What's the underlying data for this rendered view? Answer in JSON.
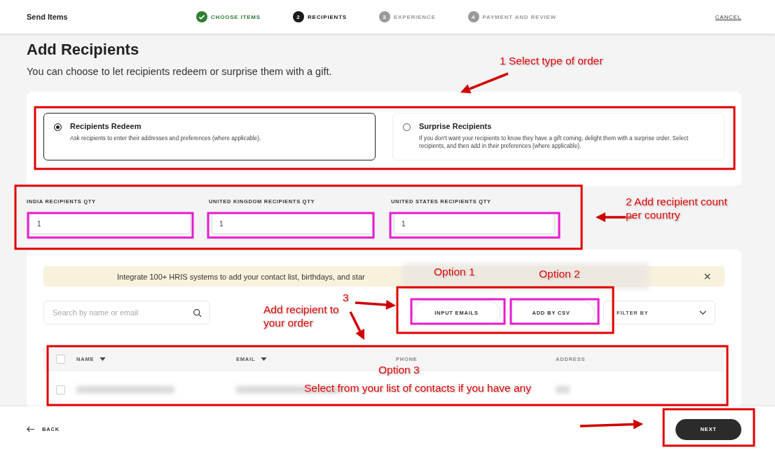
{
  "header": {
    "title": "Send Items",
    "steps": [
      {
        "label": "CHOOSE ITEMS",
        "completed": true,
        "selected": false
      },
      {
        "number": "2",
        "label": "RECIPIENTS",
        "completed": false,
        "selected": true
      },
      {
        "number": "3",
        "label": "EXPERIENCE",
        "completed": false,
        "selected": false
      },
      {
        "number": "4",
        "label": "PAYMENT AND REVIEW",
        "completed": false,
        "selected": false
      }
    ],
    "cancel": "CANCEL"
  },
  "page": {
    "title": "Add Recipients",
    "subtitle": "You can choose to let recipients redeem or surprise them with a gift."
  },
  "order_types": [
    {
      "title": "Recipients Redeem",
      "description": "Ask recipients to enter their addresses and preferences (where applicable).",
      "selected": true
    },
    {
      "title": "Surprise Recipients",
      "description": "If you don't want your recipients to know they have a gift coming, delight them with a surprise order. Select recipients, and then add in their preferences (where applicable).",
      "selected": false
    }
  ],
  "quantities": [
    {
      "label": "INDIA RECIPIENTS QTY",
      "value": "1"
    },
    {
      "label": "UNITED KINGDOM RECIPIENTS QTY",
      "value": "1"
    },
    {
      "label": "UNITED STATES RECIPIENTS QTY",
      "value": "1"
    }
  ],
  "banner": {
    "text": "Integrate 100+ HRIS systems to add your contact list, birthdays, and star"
  },
  "search": {
    "placeholder": "Search by name or email"
  },
  "actions": [
    "INPUT EMAILS",
    "ADD BY CSV"
  ],
  "filter": {
    "label": "FILTER BY"
  },
  "table": {
    "select_all_checked": false,
    "columns": [
      {
        "label": "NAME",
        "sortable": true
      },
      {
        "label": "EMAIL",
        "sortable": true
      },
      {
        "label": "PHONE",
        "sortable": false
      },
      {
        "label": "ADDRESS",
        "sortable": false
      }
    ],
    "rows": [
      {
        "checked": false
      }
    ]
  },
  "footer": {
    "back": "BACK",
    "next": "NEXT"
  },
  "annotations": {
    "labels": [
      "1 Select type of order",
      "2  Add recipient count per country",
      "Option 1",
      "Option 2",
      "3",
      "Add recipient to your order",
      "Option 3",
      "Select from your list of contacts if you have any"
    ]
  }
}
